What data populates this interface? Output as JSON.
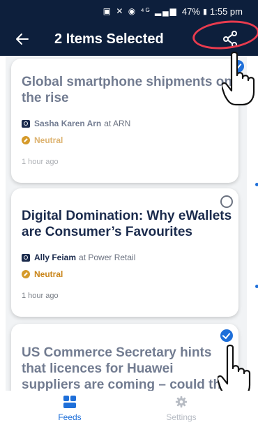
{
  "status_bar": {
    "icons": "▣ ✕ ◉ ⁴ᴳ ▂▄▆",
    "battery": "47%",
    "time": "1:55 pm"
  },
  "app_bar": {
    "title": "2 Items Selected"
  },
  "cards": [
    {
      "title": "Global smartphone shipments on the rise",
      "author": "Sasha Karen Arn",
      "at": "at ARN",
      "sentiment": "Neutral",
      "time": "1 hour ago",
      "selected": true
    },
    {
      "title": "Digital Domination: Why eWallets are Consumer’s Favourites",
      "author": "Ally Feiam",
      "at": "at Power Retail",
      "sentiment": "Neutral",
      "time": "1 hour ago",
      "selected": false
    },
    {
      "title": "US Commerce Secretary hints that licences for Huawei suppliers are coming – could this be",
      "selected": true
    }
  ],
  "bottom_nav": {
    "feeds": "Feeds",
    "settings": "Settings"
  },
  "colors": {
    "header": "#0d1f3c",
    "accent": "#1e6fd9",
    "annotation": "#e83b4e",
    "sentiment": "#c9851a"
  },
  "icons": {
    "back": "arrow-left-icon",
    "share": "share-icon",
    "feeds": "feeds-icon",
    "settings": "gear-icon",
    "pointer": "hand-pointer-icon"
  }
}
